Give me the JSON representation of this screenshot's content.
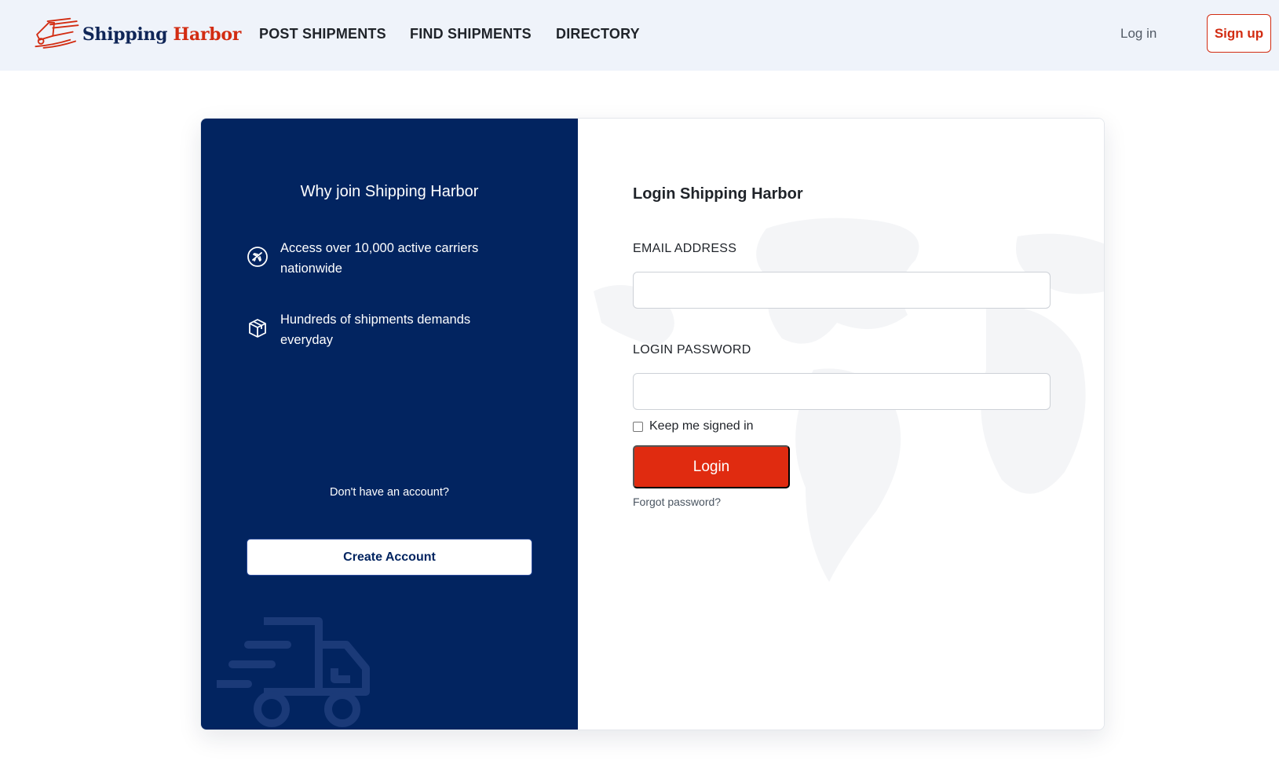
{
  "header": {
    "brand": {
      "word1": "Shipping",
      "word2": "Harbor"
    },
    "nav": {
      "post_shipments": "POST SHIPMENTS",
      "find_shipments": "FIND SHIPMENTS",
      "directory": "DIRECTORY"
    },
    "login_link": "Log in",
    "signup_button": "Sign up"
  },
  "promo": {
    "title": "Why join Shipping Harbor",
    "benefits": [
      {
        "icon": "airplane-circle-icon",
        "text": "Access over 10,000 active carriers nationwide"
      },
      {
        "icon": "package-box-icon",
        "text": "Hundreds of shipments demands everyday"
      }
    ],
    "no_account_text": "Don't have an account?",
    "create_account_button": "Create Account"
  },
  "login_form": {
    "title": "Login Shipping Harbor",
    "email_label": "EMAIL ADDRESS",
    "email_value": "",
    "password_label": "LOGIN PASSWORD",
    "password_value": "",
    "keep_signed_in_label": "Keep me signed in",
    "keep_signed_in_checked": false,
    "login_button": "Login",
    "forgot_password_link": "Forgot password?"
  },
  "colors": {
    "brand_navy": "#022460",
    "brand_red": "#e02b10",
    "header_bg": "#eff3fa"
  }
}
